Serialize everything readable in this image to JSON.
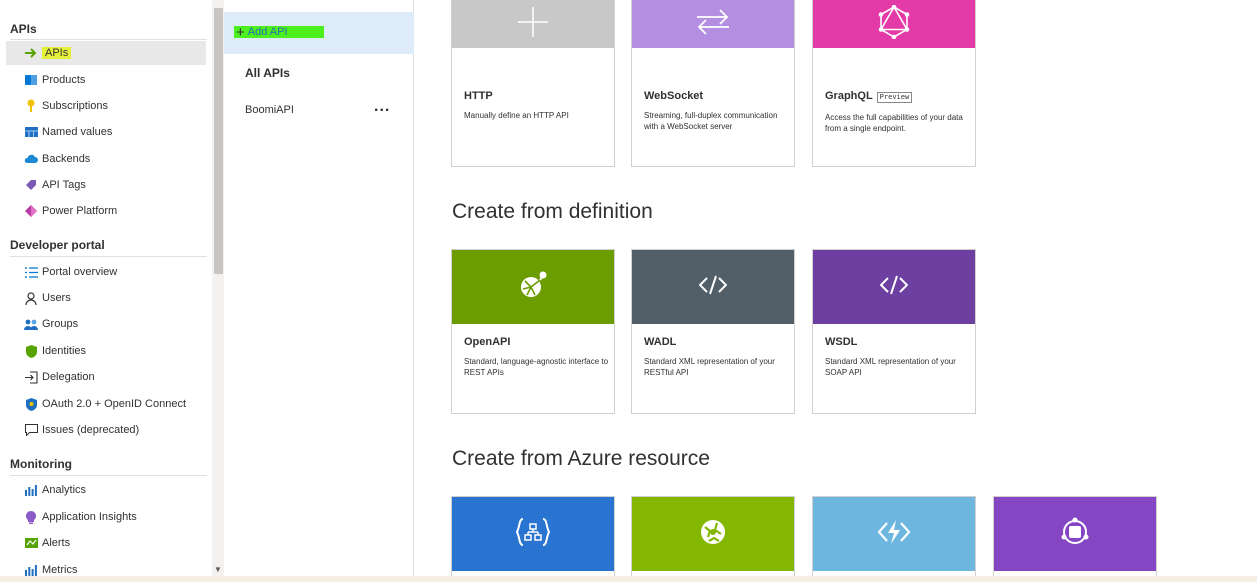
{
  "sidebar": {
    "sections": [
      {
        "header": "APIs"
      },
      {
        "header": "Developer portal"
      },
      {
        "header": "Monitoring"
      }
    ],
    "items": [
      {
        "label": "APIs",
        "icon": "arrow-right-icon",
        "active": true
      },
      {
        "label": "Products",
        "icon": "products-icon"
      },
      {
        "label": "Subscriptions",
        "icon": "key-icon"
      },
      {
        "label": "Named values",
        "icon": "table-icon"
      },
      {
        "label": "Backends",
        "icon": "cloud-icon"
      },
      {
        "label": "API Tags",
        "icon": "tag-icon"
      },
      {
        "label": "Power Platform",
        "icon": "power-platform-icon"
      },
      {
        "label": "Portal overview",
        "icon": "list-icon"
      },
      {
        "label": "Users",
        "icon": "user-icon"
      },
      {
        "label": "Groups",
        "icon": "group-icon"
      },
      {
        "label": "Identities",
        "icon": "shield-icon"
      },
      {
        "label": "Delegation",
        "icon": "sign-in-icon"
      },
      {
        "label": "OAuth 2.0 + OpenID Connect",
        "icon": "shield-lock-icon"
      },
      {
        "label": "Issues (deprecated)",
        "icon": "comment-icon"
      },
      {
        "label": "Analytics",
        "icon": "bar-chart-icon"
      },
      {
        "label": "Application Insights",
        "icon": "bulb-icon"
      },
      {
        "label": "Alerts",
        "icon": "alert-icon"
      },
      {
        "label": "Metrics",
        "icon": "bar-chart-icon"
      }
    ]
  },
  "apilist": {
    "add_label": "Add API",
    "all_label": "All APIs",
    "apis": [
      {
        "name": "BoomiAPI",
        "more": "..."
      }
    ]
  },
  "content": {
    "top_tiles": [
      {
        "title": "HTTP",
        "desc": "Manually define an HTTP API",
        "color": "#c8c8c8",
        "icon": "plus-icon"
      },
      {
        "title": "WebSocket",
        "desc": "Streaming, full-duplex communication with a WebSocket server",
        "color": "#b48ee0",
        "icon": "swap-arrows-icon"
      },
      {
        "title": "GraphQL",
        "badge": "Preview",
        "desc": "Access the full capabilities of your data from a single endpoint.",
        "color": "#e33aa8",
        "icon": "graphql-icon"
      }
    ],
    "definition_title": "Create from definition",
    "definition_tiles": [
      {
        "title": "OpenAPI",
        "desc": "Standard, language-agnostic interface to REST APIs",
        "color": "#6b9c00",
        "icon": "openapi-icon"
      },
      {
        "title": "WADL",
        "desc": "Standard XML representation of your RESTful API",
        "color": "#525e68",
        "icon": "code-icon"
      },
      {
        "title": "WSDL",
        "desc": "Standard XML representation of your SOAP API",
        "color": "#6d3fa0",
        "icon": "code-icon"
      }
    ],
    "azure_title": "Create from Azure resource",
    "azure_tiles": [
      {
        "color": "#2874d0",
        "icon": "logic-app-icon"
      },
      {
        "color": "#83b700",
        "icon": "app-service-icon"
      },
      {
        "color": "#6cb6e0",
        "icon": "function-app-icon"
      },
      {
        "color": "#8546c4",
        "icon": "container-app-icon"
      }
    ]
  }
}
